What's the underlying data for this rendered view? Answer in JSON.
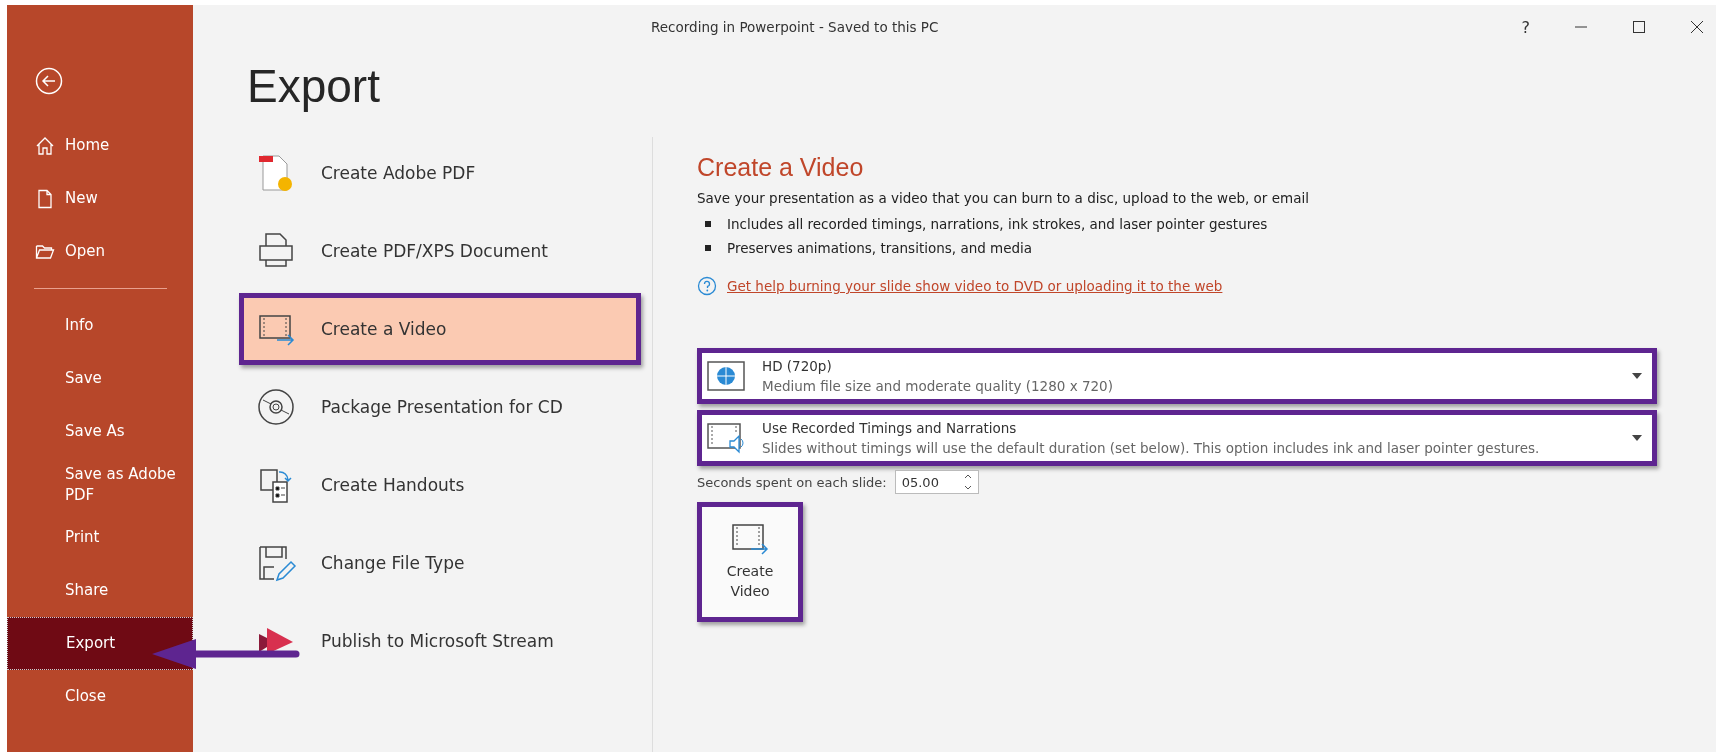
{
  "window": {
    "title": "Recording in Powerpoint  -  Saved to this PC",
    "help": "?"
  },
  "sidebar": {
    "items": [
      {
        "label": "Home",
        "kind": "home",
        "selected": false
      },
      {
        "label": "New",
        "kind": "new",
        "selected": false
      },
      {
        "label": "Open",
        "kind": "open",
        "selected": false
      },
      {
        "label": "Info",
        "kind": "plain",
        "selected": false
      },
      {
        "label": "Save",
        "kind": "plain",
        "selected": false
      },
      {
        "label": "Save As",
        "kind": "plain",
        "selected": false
      },
      {
        "label": "Save as Adobe PDF",
        "kind": "plain",
        "selected": false
      },
      {
        "label": "Print",
        "kind": "plain",
        "selected": false
      },
      {
        "label": "Share",
        "kind": "plain",
        "selected": false
      },
      {
        "label": "Export",
        "kind": "plain",
        "selected": true
      },
      {
        "label": "Close",
        "kind": "plain",
        "selected": false
      }
    ]
  },
  "heading": "Export",
  "export_options": [
    {
      "label": "Create Adobe PDF",
      "kind": "adobe",
      "selected": false
    },
    {
      "label": "Create PDF/XPS Document",
      "kind": "printer",
      "selected": false
    },
    {
      "label": "Create a Video",
      "kind": "video",
      "selected": true
    },
    {
      "label": "Package Presentation for CD",
      "kind": "cd",
      "selected": false
    },
    {
      "label": "Create Handouts",
      "kind": "handouts",
      "selected": false
    },
    {
      "label": "Change File Type",
      "kind": "filetype",
      "selected": false
    },
    {
      "label": "Publish to Microsoft Stream",
      "kind": "stream",
      "selected": false
    }
  ],
  "detail": {
    "title": "Create a Video",
    "description": "Save your presentation as a video that you can burn to a disc, upload to the web, or email",
    "bullets": [
      "Includes all recorded timings, narrations, ink strokes, and laser pointer gestures",
      "Preserves animations, transitions, and media"
    ],
    "help_link": "Get help burning your slide show video to DVD or uploading it to the web",
    "dropdowns": [
      {
        "kind": "quality",
        "title": "HD (720p)",
        "subtitle": "Medium file size and moderate quality (1280 x 720)"
      },
      {
        "kind": "narration",
        "title": "Use Recorded Timings and Narrations",
        "subtitle": "Slides without timings will use the default duration (set below). This option includes ink and laser pointer gestures."
      }
    ],
    "seconds": {
      "label": "Seconds spent on each slide:",
      "value": "05.00"
    },
    "create_button": {
      "line_1": "Create",
      "line_2": "Video"
    }
  }
}
